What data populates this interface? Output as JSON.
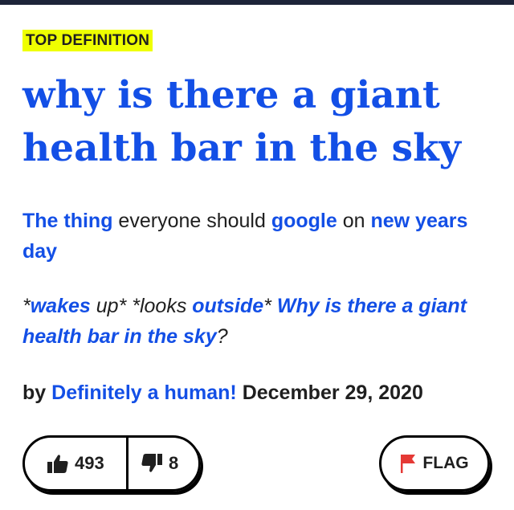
{
  "badge": "TOP DEFINITION",
  "word": "why is there a giant health bar in the sky",
  "meaning": {
    "part1": "The thing",
    "part2": " everyone should ",
    "part3": "google",
    "part4": " on ",
    "part5": "new years day"
  },
  "example": {
    "part1": "*",
    "part2": "wakes",
    "part3": " up* *looks ",
    "part4": "outside",
    "part5": "* ",
    "part6": "Why is there a giant health bar in the sky",
    "part7": "?"
  },
  "byline": {
    "by": "by",
    "author": "Definitely a human!",
    "date": "December 29, 2020"
  },
  "votes": {
    "up": "493",
    "down": "8"
  },
  "flag_label": "FLAG",
  "colors": {
    "link_blue": "#134fe6",
    "badge_yellow": "#efff00",
    "flag_red": "#e53935"
  },
  "icons": [
    "thumbs-up-icon",
    "thumbs-down-icon",
    "flag-icon"
  ]
}
